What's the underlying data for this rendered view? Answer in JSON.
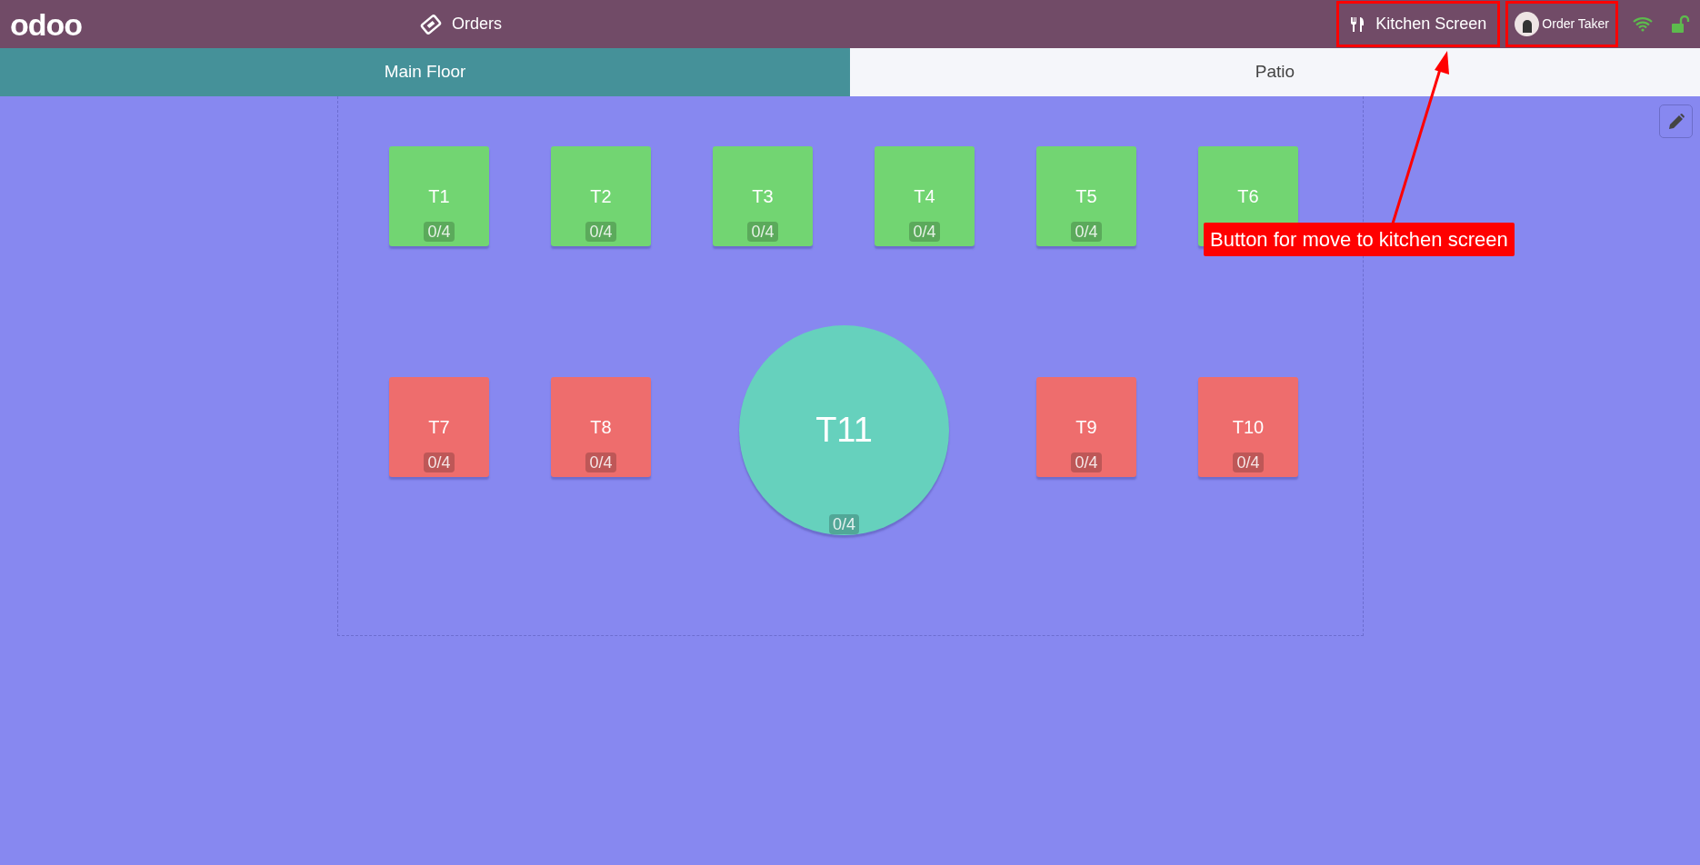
{
  "header": {
    "logo": "odoo",
    "orders": {
      "label": "Orders"
    },
    "kitchen_screen": {
      "label": "Kitchen Screen",
      "highlighted": true
    },
    "user": {
      "name": "Order Taker",
      "highlighted": true
    }
  },
  "floor_tabs": [
    {
      "label": "Main Floor",
      "selected": true
    },
    {
      "label": "Patio",
      "selected": false
    }
  ],
  "tables": [
    {
      "name": "T1",
      "seats": "0/4",
      "kind": "square",
      "color": "#72d572"
    },
    {
      "name": "T2",
      "seats": "0/4",
      "kind": "square",
      "color": "#72d572"
    },
    {
      "name": "T3",
      "seats": "0/4",
      "kind": "square",
      "color": "#72d572"
    },
    {
      "name": "T4",
      "seats": "0/4",
      "kind": "square",
      "color": "#72d572"
    },
    {
      "name": "T5",
      "seats": "0/4",
      "kind": "square",
      "color": "#72d572"
    },
    {
      "name": "T6",
      "kind": "square",
      "color": "#72d572"
    },
    {
      "name": "T7",
      "seats": "0/4",
      "kind": "square",
      "color": "#ee6d6d"
    },
    {
      "name": "T8",
      "seats": "0/4",
      "kind": "square",
      "color": "#ee6d6d"
    },
    {
      "name": "T11",
      "seats": "0/4",
      "kind": "round",
      "color": "#66d1bd"
    },
    {
      "name": "T9",
      "seats": "0/4",
      "kind": "square",
      "color": "#ee6d6d"
    },
    {
      "name": "T10",
      "seats": "0/4",
      "kind": "square",
      "color": "#ee6d6d"
    }
  ],
  "annotation": {
    "text": "Button for move to kitchen screen"
  }
}
